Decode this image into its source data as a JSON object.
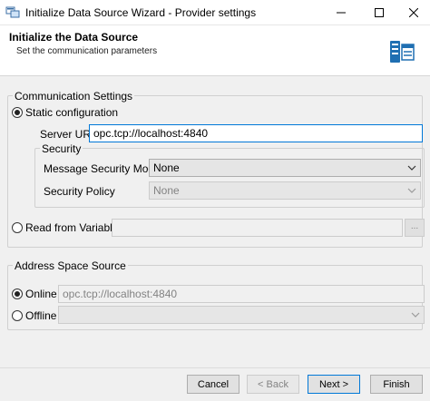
{
  "window": {
    "title": "Initialize Data Source Wizard - Provider settings",
    "controls": {
      "minimize": "—",
      "maximize": "☐",
      "close": "✕"
    }
  },
  "header": {
    "title": "Initialize the Data Source",
    "subtitle": "Set the communication parameters"
  },
  "communication": {
    "legend": "Communication Settings",
    "static_label": "Static configuration",
    "static_checked": true,
    "server_uri_label": "Server URI",
    "server_uri_value": "opc.tcp://localhost:4840",
    "security": {
      "legend": "Security",
      "mode_label": "Message Security Mode",
      "mode_value": "None",
      "policy_label": "Security Policy",
      "policy_value": "None"
    },
    "variable_label": "Read from Variable",
    "variable_value": "",
    "browse_label": "..."
  },
  "address_space": {
    "legend": "Address Space Source",
    "online_label": "Online",
    "online_checked": true,
    "online_value": "opc.tcp://localhost:4840",
    "offline_label": "Offline",
    "offline_value": ""
  },
  "buttons": {
    "cancel": "Cancel",
    "back": "< Back",
    "next": "Next >",
    "finish": "Finish"
  },
  "colors": {
    "accent": "#0078d7",
    "header_bg": "#ffffff",
    "dialog_bg": "#f0f0f0"
  }
}
